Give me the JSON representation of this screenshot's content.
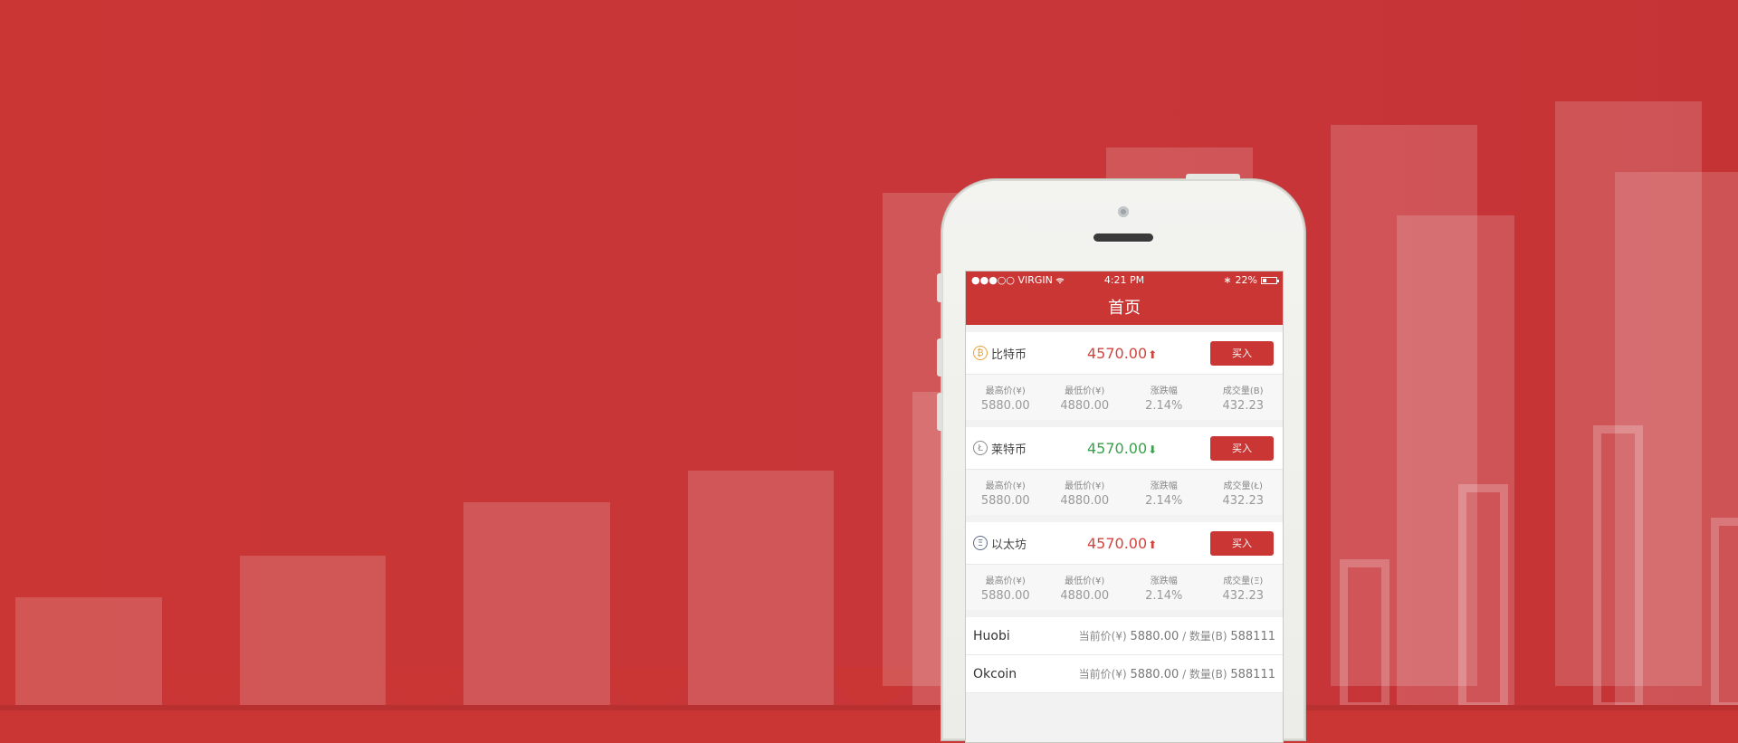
{
  "colors": {
    "brand_red": "#c93634",
    "up_red": "#d0453f",
    "down_green": "#3aa14a"
  },
  "statusbar": {
    "carrier": "●●●○○ VIRGIN",
    "wifi_icon": "wifi-icon",
    "time": "4:21 PM",
    "bluetooth": "∗",
    "battery": "22%"
  },
  "navbar": {
    "title": "首页"
  },
  "buy_label": "买入",
  "coins": [
    {
      "name": "比特币",
      "icon_glyph": "₿",
      "icon_color": "#e8a23a",
      "price": "4570.00",
      "trend": "up",
      "arrow": "⬆",
      "stats": [
        {
          "label": "最高价(¥)",
          "value": "5880.00"
        },
        {
          "label": "最低价(¥)",
          "value": "4880.00"
        },
        {
          "label": "涨跌幅",
          "value": "2.14%"
        },
        {
          "label": "成交量(B)",
          "value": "432.23"
        }
      ]
    },
    {
      "name": "莱特币",
      "icon_glyph": "Ł",
      "icon_color": "#8a8a8a",
      "price": "4570.00",
      "trend": "down",
      "arrow": "⬇",
      "stats": [
        {
          "label": "最高价(¥)",
          "value": "5880.00"
        },
        {
          "label": "最低价(¥)",
          "value": "4880.00"
        },
        {
          "label": "涨跌幅",
          "value": "2.14%"
        },
        {
          "label": "成交量(Ł)",
          "value": "432.23"
        }
      ]
    },
    {
      "name": "以太坊",
      "icon_glyph": "Ξ",
      "icon_color": "#5e6a86",
      "price": "4570.00",
      "trend": "up",
      "arrow": "⬆",
      "stats": [
        {
          "label": "最高价(¥)",
          "value": "5880.00"
        },
        {
          "label": "最低价(¥)",
          "value": "4880.00"
        },
        {
          "label": "涨跌幅",
          "value": "2.14%"
        },
        {
          "label": "成交量(Ξ)",
          "value": "432.23"
        }
      ]
    }
  ],
  "exchanges": [
    {
      "name": "Huobi",
      "info_prefix": "当前价(¥)",
      "price": "5880.00",
      "sep": " / 数量(B)",
      "qty": "588111"
    },
    {
      "name": "Okcoin",
      "info_prefix": "当前价(¥)",
      "price": "5880.00",
      "sep": " / 数量(B)",
      "qty": "588111"
    }
  ]
}
